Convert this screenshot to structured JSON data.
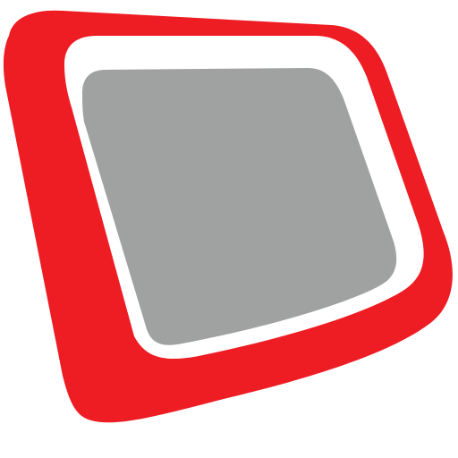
{
  "icon": {
    "name": "screen-frame-icon",
    "colors": {
      "outer_frame": "#EE1C23",
      "inner_border": "#FFFFFF",
      "screen": "#A0A1A1",
      "background": "#FFFFFF"
    }
  }
}
